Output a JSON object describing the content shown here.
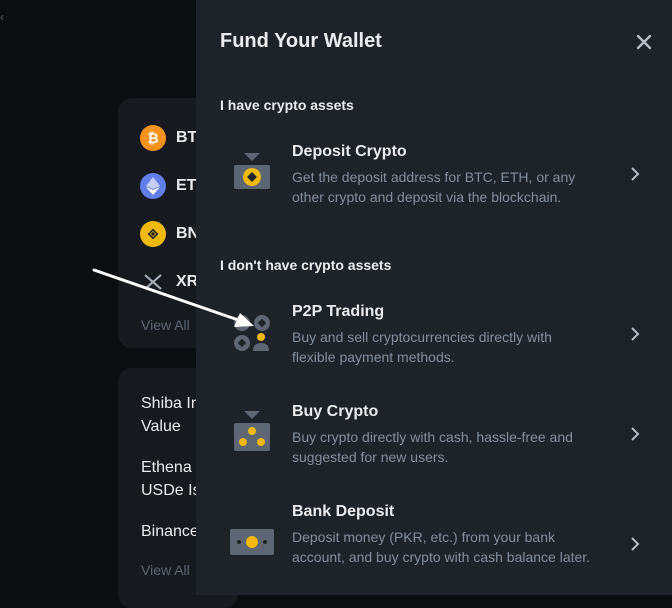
{
  "background": {
    "coins": [
      {
        "symbol": "BT",
        "icon": "bitcoin-icon",
        "color": "#f7931a"
      },
      {
        "symbol": "ET",
        "icon": "ethereum-icon",
        "color": "#627eea"
      },
      {
        "symbol": "BN",
        "icon": "bnb-icon",
        "color": "#f0b90b"
      },
      {
        "symbol": "XR",
        "icon": "xrp-icon",
        "color": "#23292f"
      }
    ],
    "view_all_1": "View All",
    "news": [
      "Shiba In\nValue",
      "Ethena\nUSDe Is",
      "Binance"
    ],
    "view_all_2": "View All"
  },
  "panel": {
    "title": "Fund Your Wallet",
    "section_crypto": "I have crypto assets",
    "section_no_crypto": "I don't have crypto assets",
    "options": [
      {
        "title": "Deposit Crypto",
        "desc": "Get the deposit address for BTC, ETH, or any other crypto and deposit via the blockchain."
      },
      {
        "title": "P2P Trading",
        "desc": "Buy and sell cryptocurrencies directly with flexible payment methods."
      },
      {
        "title": "Buy Crypto",
        "desc": "Buy crypto directly with cash, hassle-free and suggested for new users."
      },
      {
        "title": "Bank Deposit",
        "desc": "Deposit money (PKR, etc.) from your bank account, and buy crypto with cash balance later."
      }
    ]
  },
  "colors": {
    "accent": "#f0b90b",
    "panel_bg": "#1e2329",
    "page_bg": "#0b0e11",
    "muted_text": "#848e9c"
  }
}
